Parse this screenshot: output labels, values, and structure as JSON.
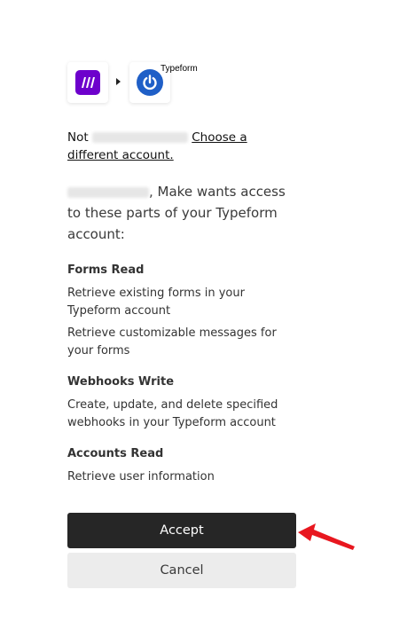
{
  "header": {
    "make_icon": "make-logo-icon",
    "typeform_icon": "typeform-power-icon",
    "typeform_label": "Typeform"
  },
  "account": {
    "not_label": "Not",
    "choose_link": "Choose a different account."
  },
  "intro": {
    "text": ", Make wants access to these parts of your Typeform account:"
  },
  "permissions": [
    {
      "title": "Forms Read",
      "items": [
        "Retrieve existing forms in your Typeform account",
        "Retrieve customizable messages for your forms"
      ]
    },
    {
      "title": "Webhooks Write",
      "items": [
        "Create, update, and delete specified webhooks in your Typeform account"
      ]
    },
    {
      "title": "Accounts Read",
      "items": [
        "Retrieve user information"
      ]
    }
  ],
  "actions": {
    "accept_label": "Accept",
    "cancel_label": "Cancel"
  },
  "colors": {
    "make_brand": "#6d00cc",
    "typeform_brand": "#1f5fc7",
    "accept_bg": "#262626",
    "cancel_bg": "#ececec",
    "annotation_arrow": "#e8171f"
  }
}
